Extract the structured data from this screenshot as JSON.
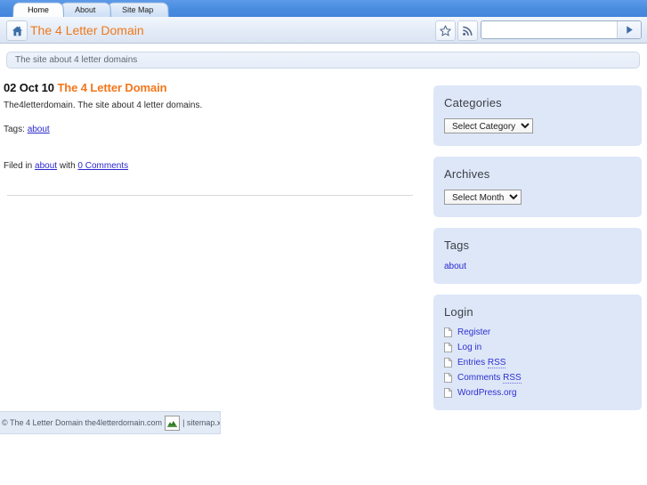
{
  "browser": {
    "tabs": [
      {
        "label": "Home",
        "active": true
      },
      {
        "label": "About",
        "active": false
      },
      {
        "label": "Site Map",
        "active": false
      }
    ],
    "home_icon": "home-icon",
    "star_icon": "bookmark-star-icon",
    "rss_icon": "rss-feed-icon",
    "go_icon": "go-arrow-icon",
    "address": {
      "value": "",
      "placeholder": ""
    }
  },
  "site": {
    "title": "The 4 Letter Domain",
    "tagline": "The site about 4 letter domains"
  },
  "post": {
    "date": "02 Oct 10",
    "title": "The 4 Letter Domain",
    "body": "The4letterdomain.  The site about 4 letter domains.",
    "tags_label": "Tags:",
    "tags_link": "about",
    "filed_prefix": "Filed in",
    "filed_link": "about",
    "filed_mid": "with",
    "comments_link": "0 Comments"
  },
  "sidebar": {
    "widgets": [
      {
        "name": "categories",
        "title": "Categories",
        "type": "select",
        "selected": "Select Category",
        "options": [
          "Select Category"
        ]
      },
      {
        "name": "archives",
        "title": "Archives",
        "type": "select",
        "selected": "Select Month",
        "options": [
          "Select Month"
        ]
      },
      {
        "name": "tags",
        "title": "Tags",
        "type": "tagcloud",
        "tags": [
          "about"
        ]
      },
      {
        "name": "login",
        "title": "Login",
        "type": "links",
        "links": [
          {
            "label": "Register",
            "abbr": ""
          },
          {
            "label": "Log in",
            "abbr": ""
          },
          {
            "label": "Entries ",
            "abbr": "RSS"
          },
          {
            "label": "Comments ",
            "abbr": "RSS"
          },
          {
            "label": "WordPress.org",
            "abbr": ""
          }
        ]
      }
    ]
  },
  "footer": {
    "copyright": "© The 4 Letter Domain the4letterdomain.com",
    "image_icon": "broken-image-icon",
    "separator": "|",
    "sitemap_link": "sitemap.xml"
  },
  "colors": {
    "accent_orange": "#f07818",
    "tab_blue": "#4a8ddf",
    "widget_bg": "#dde7f8",
    "link_blue": "#2a28cf"
  }
}
